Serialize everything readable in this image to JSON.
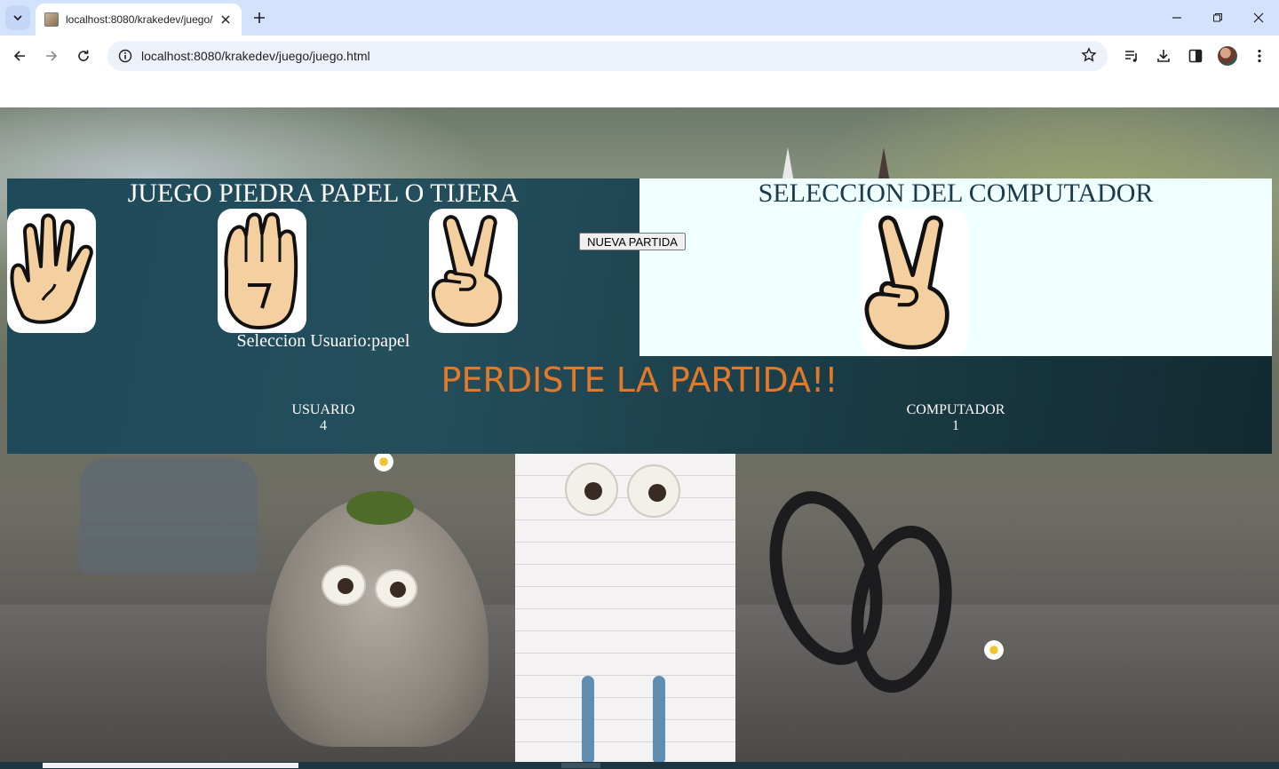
{
  "browser": {
    "tab_title": "localhost:8080/krakedev/juego/",
    "url": "localhost:8080/krakedev/juego/juego.html"
  },
  "game": {
    "title": "JUEGO PIEDRA PAPEL O TIJERA",
    "computer_title": "SELECCION DEL COMPUTADOR",
    "user_selection": "Seleccion Usuario:papel",
    "result": "PERDISTE LA PARTIDA!!",
    "user_label": "USUARIO",
    "user_score": "4",
    "computer_label": "COMPUTADOR",
    "computer_score": "1",
    "new_game_button": "NUEVA PARTIDA",
    "options": [
      {
        "name": "papel",
        "icon": "open-hand-icon"
      },
      {
        "name": "piedra",
        "icon": "fist-icon"
      },
      {
        "name": "tijera",
        "icon": "victory-hand-icon"
      }
    ],
    "computer_choice_icon": "victory-hand-icon"
  },
  "colors": {
    "panel_dark": "#1e4a5a",
    "panel_light": "#f0ffff",
    "result_text": "#e07a2a",
    "tabstrip": "#d3e3fd"
  }
}
